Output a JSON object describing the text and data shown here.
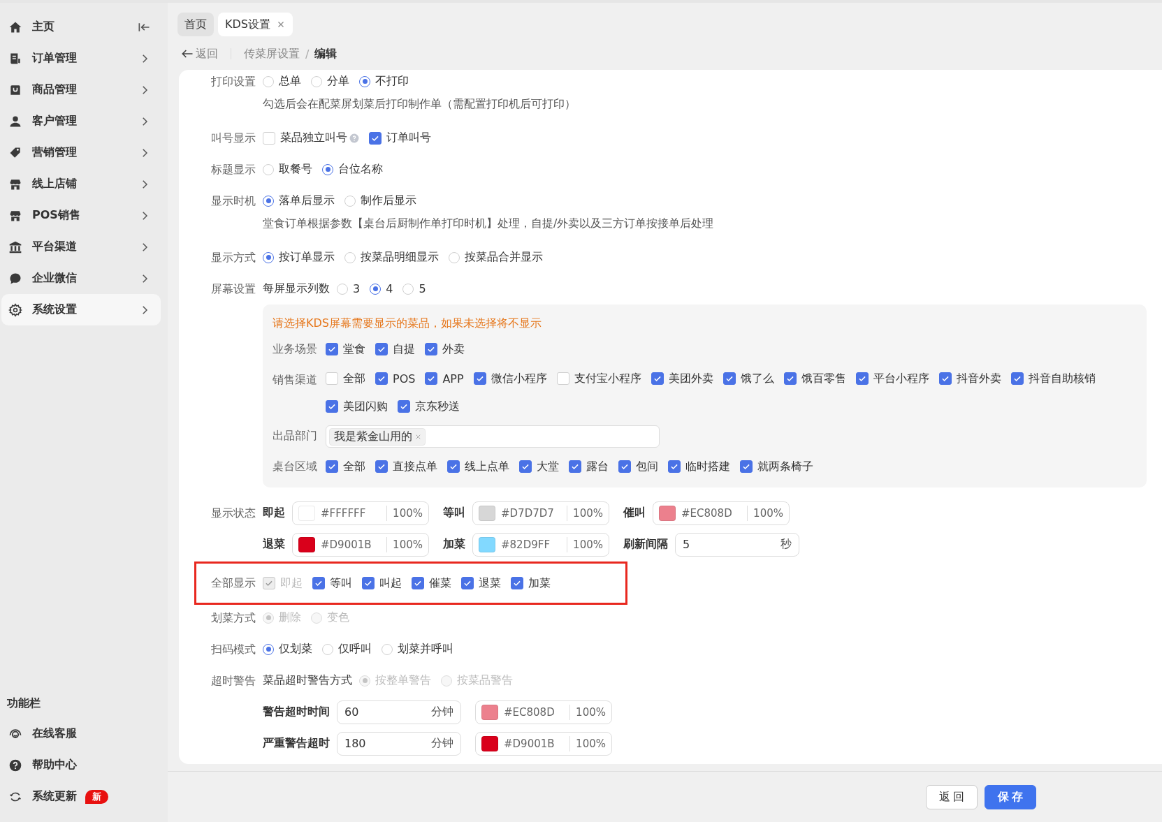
{
  "sidebar": {
    "items": [
      {
        "kind": "home",
        "label": "主页",
        "selected": false
      },
      {
        "kind": "receipt",
        "label": "订单管理",
        "selected": false
      },
      {
        "kind": "bag",
        "label": "商品管理",
        "selected": false
      },
      {
        "kind": "person",
        "label": "客户管理",
        "selected": false
      },
      {
        "kind": "tag",
        "label": "营销管理",
        "selected": false
      },
      {
        "kind": "store",
        "label": "线上店铺",
        "selected": false
      },
      {
        "kind": "store",
        "label": "POS销售",
        "selected": false
      },
      {
        "kind": "bank",
        "label": "平台渠道",
        "selected": false
      },
      {
        "kind": "chat",
        "label": "企业微信",
        "selected": false
      },
      {
        "kind": "gear",
        "label": "系统设置",
        "selected": true
      }
    ],
    "tools_title": "功能栏",
    "tools": [
      {
        "kind": "headset",
        "label": "在线客服"
      },
      {
        "kind": "help",
        "label": "帮助中心"
      },
      {
        "kind": "refresh",
        "label": "系统更新",
        "badge": "新"
      }
    ]
  },
  "tabs": [
    {
      "label": "首页",
      "selected": false,
      "closable": false
    },
    {
      "label": "KDS设置",
      "selected": true,
      "closable": true
    }
  ],
  "breadcrumb": {
    "back": "返回",
    "separator": "/",
    "path": [
      {
        "label": "传菜屏设置",
        "current": false
      },
      {
        "label": "编辑",
        "current": true
      }
    ]
  },
  "form": [
    {
      "label": "打印设置",
      "kind": "radio",
      "options": [
        {
          "label": "总单",
          "selected": false
        },
        {
          "label": "分单",
          "selected": false
        },
        {
          "label": "不打印",
          "selected": true
        }
      ],
      "note": "勾选后会在配菜屏划菜后打印制作单（需配置打印机后可打印）"
    },
    {
      "label": "叫号显示",
      "kind": "check",
      "options": [
        {
          "label": "菜品独立叫号",
          "checked": false,
          "help": true
        },
        {
          "label": "订单叫号",
          "checked": true
        }
      ]
    },
    {
      "label": "标题显示",
      "kind": "radio",
      "options": [
        {
          "label": "取餐号",
          "selected": false
        },
        {
          "label": "台位名称",
          "selected": true
        }
      ]
    },
    {
      "label": "显示时机",
      "kind": "radio",
      "options": [
        {
          "label": "落单后显示",
          "selected": true
        },
        {
          "label": "制作后显示",
          "selected": false
        }
      ],
      "note": "堂食订单根据参数【桌台后厨制作单打印时机】处理，自提/外卖以及三方订单按接单后处理"
    },
    {
      "label": "显示方式",
      "kind": "radio",
      "options": [
        {
          "label": "按订单显示",
          "selected": true
        },
        {
          "label": "按菜品明细显示",
          "selected": false
        },
        {
          "label": "按菜品合并显示",
          "selected": false
        }
      ]
    },
    {
      "label": "屏幕设置",
      "kind": "radio",
      "sublabel": "每屏显示列数",
      "options": [
        {
          "label": "3",
          "selected": false
        },
        {
          "label": "4",
          "selected": true
        },
        {
          "label": "5",
          "selected": false
        }
      ],
      "panel": {
        "notice": "请选择KDS屏幕需要显示的菜品，如果未选择将不显示",
        "rows": [
          {
            "label": "业务场景",
            "kind": "check",
            "options": [
              {
                "label": "堂食",
                "checked": true
              },
              {
                "label": "自提",
                "checked": true
              },
              {
                "label": "外卖",
                "checked": true
              }
            ]
          },
          {
            "label": "销售渠道",
            "kind": "check",
            "options": [
              {
                "label": "全部",
                "checked": false
              },
              {
                "label": "POS",
                "checked": true
              },
              {
                "label": "APP",
                "checked": true
              },
              {
                "label": "微信小程序",
                "checked": true
              },
              {
                "label": "支付宝小程序",
                "checked": false
              },
              {
                "label": "美团外卖",
                "checked": true
              },
              {
                "label": "饿了么",
                "checked": true
              },
              {
                "label": "饿百零售",
                "checked": true
              },
              {
                "label": "平台小程序",
                "checked": true
              },
              {
                "label": "抖音外卖",
                "checked": true
              },
              {
                "label": "抖音自助核销",
                "checked": true
              },
              {
                "label": "美团闪购",
                "checked": true
              },
              {
                "label": "京东秒送",
                "checked": true
              }
            ]
          },
          {
            "label": "出品部门",
            "kind": "tags",
            "tags": [
              "我是紫金山用的"
            ]
          },
          {
            "label": "桌台区域",
            "kind": "check",
            "options": [
              {
                "label": "全部",
                "checked": true
              },
              {
                "label": "直接点单",
                "checked": true
              },
              {
                "label": "线上点单",
                "checked": true
              },
              {
                "label": "大堂",
                "checked": true
              },
              {
                "label": "露台",
                "checked": true
              },
              {
                "label": "包间",
                "checked": true
              },
              {
                "label": "临时搭建",
                "checked": true
              },
              {
                "label": "就两条椅子",
                "checked": true
              }
            ]
          }
        ]
      }
    },
    {
      "label": "显示状态",
      "kind": "fields",
      "lines": [
        [
          {
            "kind": "color",
            "label": "即起",
            "color": "#ffffff",
            "hex": "#FFFFFF",
            "opacity": "100%"
          },
          {
            "kind": "color",
            "label": "等叫",
            "color": "#d7d7d7",
            "hex": "#D7D7D7",
            "opacity": "100%"
          },
          {
            "kind": "color",
            "label": "催叫",
            "color": "#ec808d",
            "hex": "#EC808D",
            "opacity": "100%"
          }
        ],
        [
          {
            "kind": "color",
            "label": "退菜",
            "color": "#d9001b",
            "hex": "#D9001B",
            "opacity": "100%"
          },
          {
            "kind": "color",
            "label": "加菜",
            "color": "#82d9ff",
            "hex": "#82D9FF",
            "opacity": "100%"
          },
          {
            "kind": "input",
            "label": "刷新间隔",
            "value": "5",
            "unit": "秒"
          }
        ]
      ]
    },
    {
      "label": "全部显示",
      "kind": "check",
      "highlighted": true,
      "options": [
        {
          "label": "即起",
          "checked": true,
          "disabled": true
        },
        {
          "label": "等叫",
          "checked": true,
          "disabled": false
        },
        {
          "label": "叫起",
          "checked": true,
          "disabled": false
        },
        {
          "label": "催菜",
          "checked": true,
          "disabled": false
        },
        {
          "label": "退菜",
          "checked": true,
          "disabled": false
        },
        {
          "label": "加菜",
          "checked": true,
          "disabled": false
        }
      ]
    },
    {
      "label": "划菜方式",
      "kind": "radio",
      "options": [
        {
          "label": "删除",
          "selected": true,
          "disabled": true
        },
        {
          "label": "变色",
          "selected": false,
          "disabled": true
        }
      ]
    },
    {
      "label": "扫码模式",
      "kind": "radio",
      "options": [
        {
          "label": "仅划菜",
          "selected": true
        },
        {
          "label": "仅呼叫",
          "selected": false
        },
        {
          "label": "划菜并呼叫",
          "selected": false
        }
      ]
    },
    {
      "label": "超时警告",
      "kind": "radio",
      "sublabel": "菜品超时警告方式",
      "options": [
        {
          "label": "按整单警告",
          "selected": true,
          "disabled": true
        },
        {
          "label": "按菜品警告",
          "selected": false,
          "disabled": true
        }
      ],
      "lines": [
        [
          {
            "kind": "input",
            "label": "警告超时时间",
            "value": "60",
            "unit": "分钟"
          },
          {
            "kind": "color",
            "color": "#ec808d",
            "hex": "#EC808D",
            "opacity": "100%"
          }
        ],
        [
          {
            "kind": "input",
            "label": "严重警告超时",
            "value": "180",
            "unit": "分钟"
          },
          {
            "kind": "color",
            "color": "#d9001b",
            "hex": "#D9001B",
            "opacity": "100%"
          }
        ]
      ]
    }
  ],
  "footer": {
    "buttons": [
      {
        "label": "返回",
        "kind": "default"
      },
      {
        "label": "保存",
        "kind": "primary"
      }
    ]
  }
}
